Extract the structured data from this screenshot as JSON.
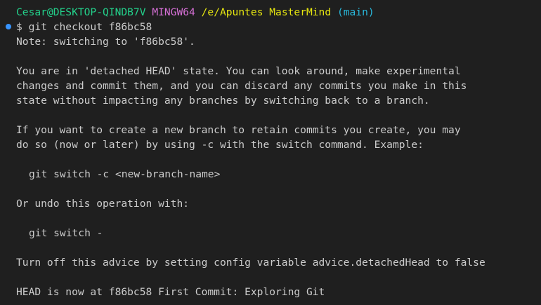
{
  "prompt": {
    "user_host": "Cesar@DESKTOP-QINDB7V",
    "system": "MINGW64",
    "path": "/e/Apuntes MasterMind",
    "branch": "(main)"
  },
  "command": "$ git checkout f86bc58",
  "output": {
    "note": "Note: switching to 'f86bc58'.",
    "detached_1": "You are in 'detached HEAD' state. You can look around, make experimental",
    "detached_2": "changes and commit them, and you can discard any commits you make in this",
    "detached_3": "state without impacting any branches by switching back to a branch.",
    "branch_1": "If you want to create a new branch to retain commits you create, you may",
    "branch_2": "do so (now or later) by using -c with the switch command. Example:",
    "example_create": "git switch -c <new-branch-name>",
    "undo": "Or undo this operation with:",
    "example_undo": "git switch -",
    "advice": "Turn off this advice by setting config variable advice.detachedHead to false",
    "head": "HEAD is now at f86bc58 First Commit: Exploring Git"
  },
  "colors": {
    "background": "#1f1f1f",
    "text": "#cccccc",
    "user": "#23d18b",
    "system": "#d670d6",
    "path": "#e5e510",
    "branch": "#29b8db",
    "decoration": "#3794ff"
  }
}
